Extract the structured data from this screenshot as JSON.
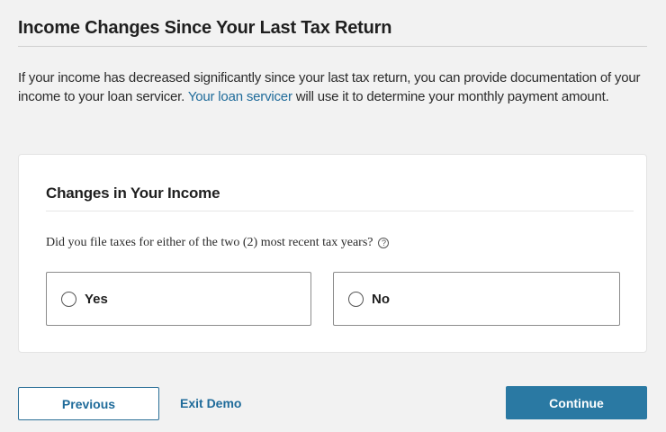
{
  "page": {
    "title": "Income Changes Since Your Last Tax Return",
    "intro_before_link": "If your income has decreased significantly since your last tax return, you can provide documentation of your income to your loan servicer. ",
    "intro_link": "Your loan servicer",
    "intro_after_link": " will use it to determine your monthly payment amount."
  },
  "card": {
    "title": "Changes in Your Income",
    "question": "Did you file taxes for either of the two (2) most recent tax years?",
    "help_icon": "question-circle-icon",
    "help_glyph": "?",
    "options": [
      {
        "label": "Yes",
        "selected": false
      },
      {
        "label": "No",
        "selected": false
      }
    ]
  },
  "footer": {
    "previous_label": "Previous",
    "exit_label": "Exit Demo",
    "continue_label": "Continue"
  },
  "colors": {
    "accent": "#2a79a3",
    "link": "#1f6b9a",
    "background": "#f2f2f2"
  }
}
